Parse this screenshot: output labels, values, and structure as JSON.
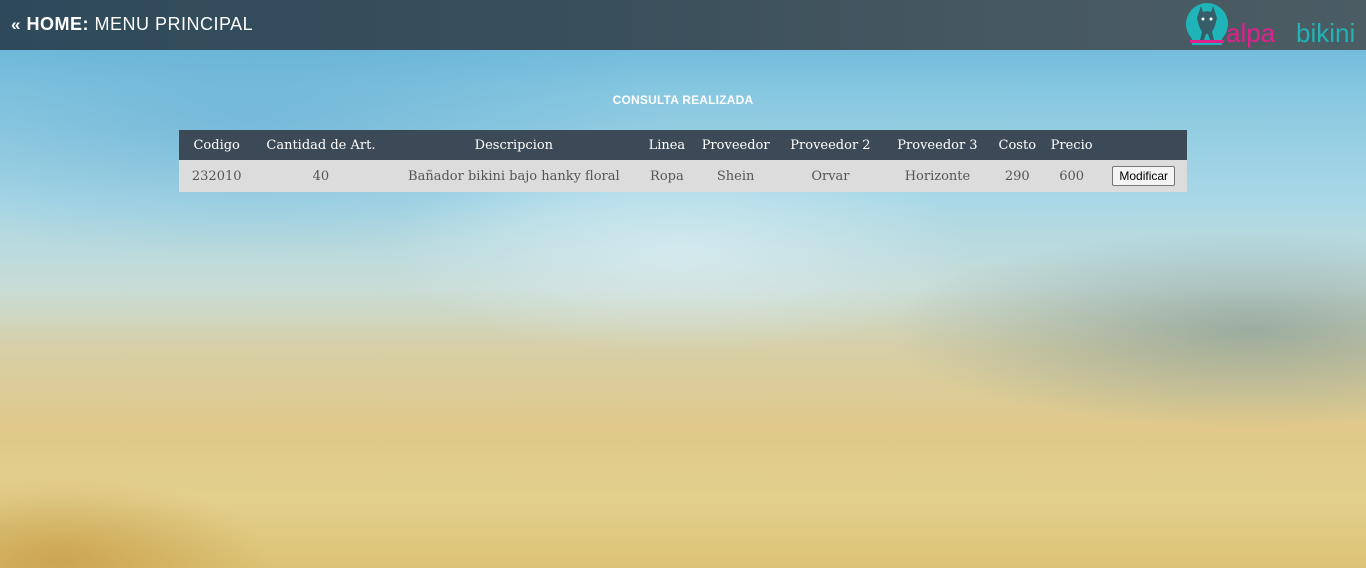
{
  "header": {
    "back_arrows": "«",
    "home_label": "HOME:",
    "menu_label": "MENU PRINCIPAL"
  },
  "logo": {
    "text_part1": "alpa",
    "text_part2": "bikini",
    "icon": "llama-icon",
    "colors": {
      "teal": "#1fb5b8",
      "pink": "#e0208c"
    }
  },
  "page": {
    "title": "CONSULTA REALIZADA"
  },
  "table": {
    "headers": [
      "Codigo",
      "Cantidad de Art.",
      "Descripcion",
      "Linea",
      "Proveedor",
      "Proveedor 2",
      "Proveedor 3",
      "Costo",
      "Precio",
      ""
    ],
    "rows": [
      {
        "codigo": "232010",
        "cantidad": "40",
        "descripcion": "Bañador bikini bajo hanky floral",
        "linea": "Ropa",
        "proveedor": "Shein",
        "proveedor2": "Orvar",
        "proveedor3": "Horizonte",
        "costo": "290",
        "precio": "600",
        "action_label": "Modificar"
      }
    ]
  }
}
